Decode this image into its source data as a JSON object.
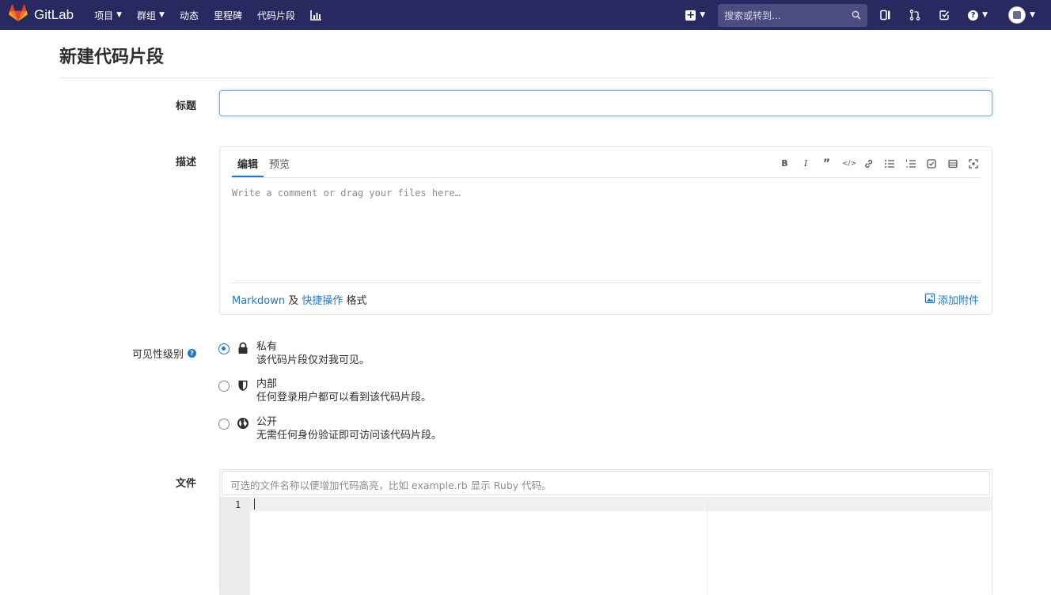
{
  "nav": {
    "brand": "GitLab",
    "items": [
      {
        "label": "项目",
        "has_caret": true
      },
      {
        "label": "群组",
        "has_caret": true
      },
      {
        "label": "动态",
        "has_caret": false
      },
      {
        "label": "里程碑",
        "has_caret": false
      },
      {
        "label": "代码片段",
        "has_caret": false
      }
    ],
    "search_placeholder": "搜索或转到...",
    "icons": [
      "chart-icon",
      "plus-square-icon",
      "search-icon",
      "sidebar-icon",
      "merge-request-icon",
      "todo-icon",
      "help-icon",
      "avatar"
    ]
  },
  "page": {
    "title": "新建代码片段",
    "title_label": "标题",
    "title_value": ""
  },
  "description": {
    "label": "描述",
    "tab_edit": "编辑",
    "tab_preview": "预览",
    "toolbar": [
      "bold-icon",
      "italic-icon",
      "quote-icon",
      "code-icon",
      "link-icon",
      "bullet-list-icon",
      "numbered-list-icon",
      "task-list-icon",
      "table-icon",
      "fullscreen-icon"
    ],
    "placeholder": "Write a comment or drag your files here…",
    "footer_markdown": "Markdown",
    "footer_and": " 及 ",
    "footer_quick": "快捷操作",
    "footer_format": " 格式",
    "attach": "添加附件"
  },
  "visibility": {
    "label": "可见性级别",
    "options": [
      {
        "title": "私有",
        "desc": "该代码片段仅对我可见。",
        "icon": "lock-icon",
        "checked": true
      },
      {
        "title": "内部",
        "desc": "任何登录用户都可以看到该代码片段。",
        "icon": "shield-icon",
        "checked": false
      },
      {
        "title": "公开",
        "desc": "无需任何身份验证即可访问该代码片段。",
        "icon": "globe-icon",
        "checked": false
      }
    ]
  },
  "file": {
    "label": "文件",
    "filename_placeholder": "可选的文件名称以便增加代码高亮，比如 example.rb 显示 Ruby 代码。",
    "line_number": "1"
  },
  "colors": {
    "navbar": "#292961",
    "link": "#1f78d1",
    "focus_border": "#73afea"
  }
}
